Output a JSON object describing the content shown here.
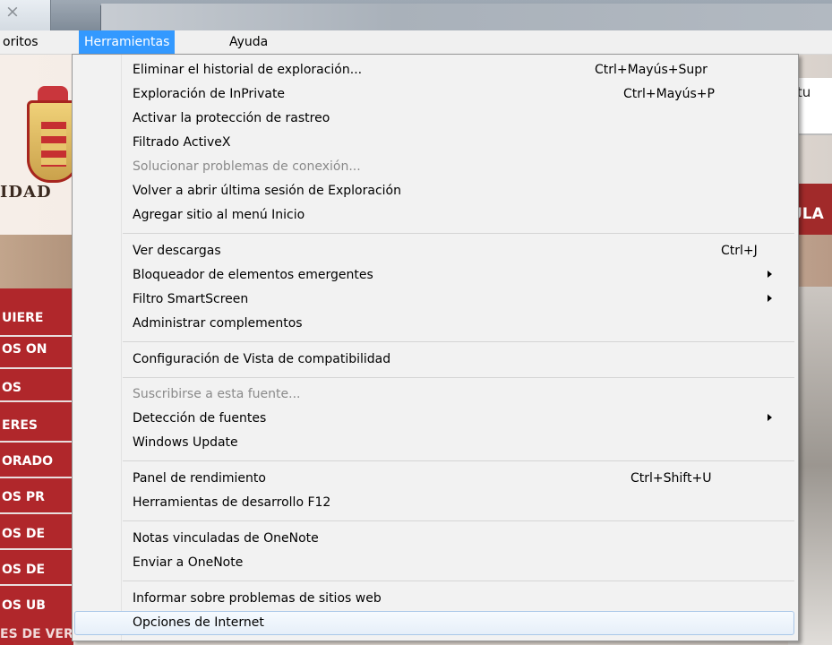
{
  "tab": {
    "close_glyph": "×"
  },
  "menubar": {
    "items": [
      "oritos",
      "Herramientas",
      "Ayuda"
    ],
    "active": "Herramientas"
  },
  "background_page": {
    "brand_fragment": "IDAD",
    "header_fragment": "ULA",
    "search_fragment": "stu",
    "sidebar": [
      "UIERE",
      "OS ON",
      "OS",
      "ERES",
      "ORADO",
      "OS PR",
      "OS DE",
      "OS DE",
      "OS UB"
    ],
    "sidebar_bottom": "ES DE VERANO"
  },
  "dropdown": {
    "items": [
      {
        "label": "Eliminar el historial de exploración...",
        "shortcut": "Ctrl+Mayús+Supr",
        "disabled": false
      },
      {
        "label": "Exploración de InPrivate",
        "shortcut": "Ctrl+Mayús+P",
        "disabled": false
      },
      {
        "label": "Activar la protección de rastreo",
        "shortcut": "",
        "disabled": false
      },
      {
        "label": "Filtrado ActiveX",
        "shortcut": "",
        "disabled": false
      },
      {
        "label": "Solucionar problemas de conexión...",
        "shortcut": "",
        "disabled": true
      },
      {
        "label": "Volver a abrir última sesión de Exploración",
        "shortcut": "",
        "disabled": false
      },
      {
        "label": "Agregar sitio al menú Inicio",
        "shortcut": "",
        "disabled": false
      },
      {
        "label": "Ver descargas",
        "shortcut": "Ctrl+J",
        "disabled": false
      },
      {
        "label": "Bloqueador de elementos emergentes",
        "shortcut": "",
        "submenu": true,
        "disabled": false
      },
      {
        "label": "Filtro SmartScreen",
        "shortcut": "",
        "submenu": true,
        "disabled": false
      },
      {
        "label": "Administrar complementos",
        "shortcut": "",
        "disabled": false
      },
      {
        "label": "Configuración de Vista de compatibilidad",
        "shortcut": "",
        "disabled": false
      },
      {
        "label": "Suscribirse a esta fuente...",
        "shortcut": "",
        "disabled": true
      },
      {
        "label": "Detección de fuentes",
        "shortcut": "",
        "submenu": true,
        "disabled": false
      },
      {
        "label": "Windows Update",
        "shortcut": "",
        "disabled": false
      },
      {
        "label": "Panel de rendimiento",
        "shortcut": "Ctrl+Shift+U",
        "disabled": false
      },
      {
        "label": "Herramientas de desarrollo F12",
        "shortcut": "",
        "disabled": false
      },
      {
        "label": "Notas vinculadas de OneNote",
        "shortcut": "",
        "disabled": false
      },
      {
        "label": "Enviar a OneNote",
        "shortcut": "",
        "disabled": false
      },
      {
        "label": "Informar sobre problemas de sitios web",
        "shortcut": "",
        "disabled": false
      },
      {
        "label": "Opciones de Internet",
        "shortcut": "",
        "disabled": false,
        "highlighted": true
      }
    ]
  },
  "colors": {
    "menu_highlight": "#3399ff",
    "site_red": "#b0272b"
  }
}
